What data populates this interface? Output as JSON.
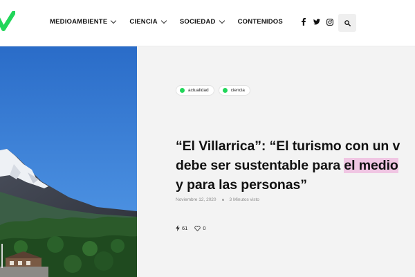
{
  "brand": {
    "accent": "#22d65a"
  },
  "nav": {
    "items": [
      {
        "label": "MEDIOAMBIENTE",
        "has_dropdown": true
      },
      {
        "label": "CIENCIA",
        "has_dropdown": true
      },
      {
        "label": "SOCIEDAD",
        "has_dropdown": true
      },
      {
        "label": "CONTENIDOS",
        "has_dropdown": false
      }
    ]
  },
  "social": {
    "icons": [
      "facebook-icon",
      "twitter-icon",
      "instagram-icon"
    ]
  },
  "search": {
    "icon": "search-icon"
  },
  "article": {
    "tags": [
      {
        "label": "actualidad",
        "color": "#22d65a"
      },
      {
        "label": "ciencia",
        "color": "#22d65a"
      }
    ],
    "title_line1": "“El Villarrica”: “El turismo con un v",
    "title_line2_before": "debe ser sustentable para ",
    "title_line2_highlight": "el medio",
    "title_line3": "y para las personas”",
    "highlight_color": "#f0c6e3",
    "date": "Noviembre 12, 2020",
    "read_time": "3 Minutos visto",
    "shares": "61",
    "likes": "0"
  }
}
